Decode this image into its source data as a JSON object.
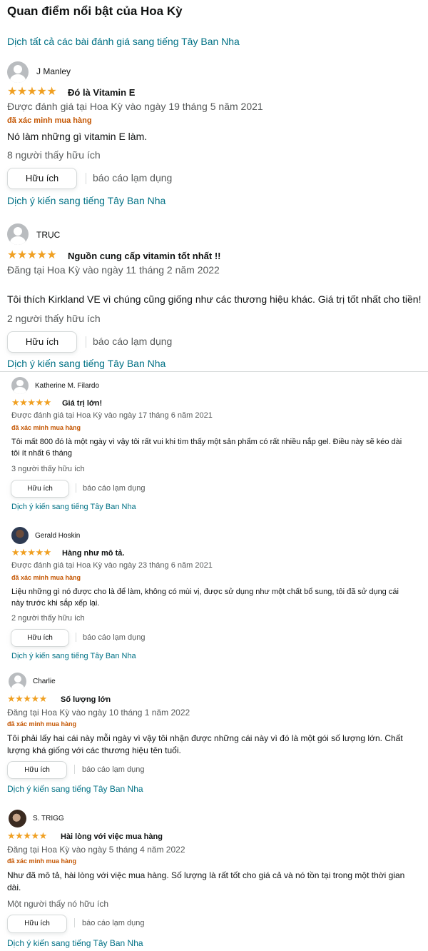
{
  "heading": "Quan điểm nổi bật của Hoa Kỳ",
  "translate_all": "Dịch tất cả các bài đánh giá sang tiếng Tây Ban Nha",
  "helpful_label": "Hữu ích",
  "report_label": "báo cáo lạm dụng",
  "translate_label": "Dịch ý kiến sang tiếng Tây Ban Nha",
  "stars_text": "★★★★★",
  "colors": {
    "link": "#007185",
    "star": "#f0a022",
    "verified": "#c45500"
  },
  "reviews": [
    {
      "name": "J Manley",
      "rating": 5,
      "title": "Đó là Vitamin E",
      "date": "Được đánh giá tại Hoa Kỳ vào ngày 19 tháng 5 năm 2021",
      "verified": "đã xác minh mua hàng",
      "body": "Nó làm những gì vitamin E làm.",
      "helpful": "8 người thấy hữu ích",
      "avatar": "avatar-generic-icon"
    },
    {
      "name": "TRỤC",
      "rating": 5,
      "title": "Nguồn cung cấp vitamin tốt nhất !!",
      "date": "Đăng tại Hoa Kỳ vào ngày 11 tháng 2 năm 2022",
      "body": "Tôi thích Kirkland VE vì chúng cũng giống như các thương hiệu khác. Giá trị tốt nhất cho tiền!",
      "helpful": "2 người thấy hữu ích",
      "avatar": "avatar-generic-icon"
    },
    {
      "name": "Katherine M. Filardo",
      "rating": 5,
      "title": "Giá trị lớn!",
      "date": "Được đánh giá tại Hoa Kỳ vào ngày 17 tháng 6 năm 2021",
      "verified": "đã xác minh mua hàng",
      "body": "Tôi mất 800 đó là một ngày vì vậy tôi rất vui khi tìm thấy một sản phẩm có rất nhiều nắp gel. Điều này sẽ kéo dài tôi ít nhất 6 tháng",
      "helpful": "3 người thấy hữu ích",
      "avatar": "avatar-generic-icon"
    },
    {
      "name": "Gerald Hoskin",
      "rating": 5,
      "title": "Hàng như mô tả.",
      "date": "Được đánh giá tại Hoa Kỳ vào ngày 23 tháng 6 năm 2021",
      "verified": "đã xác minh mua hàng",
      "body": "Liệu những gì nó được cho là để làm, không có mùi vị, được sử dụng như một chất bổ sung, tôi đã sử dụng cái này trước khi sắp xếp lại.",
      "helpful": "2 người thấy hữu ích",
      "avatar": "avatar-photo"
    },
    {
      "name": "Charlie",
      "rating": 5,
      "title": "Số lượng lớn",
      "date": "Đăng tại Hoa Kỳ vào ngày 10 tháng 1 năm 2022",
      "verified": "đã xác minh mua hàng",
      "body": "Tôi phải lấy hai cái này mỗi ngày vì vậy tôi nhận được những cái này vì đó là một gói số lượng lớn. Chất lượng khá giống với các thương hiệu tên tuổi.",
      "avatar": "avatar-generic-icon"
    },
    {
      "name": "S. TRIGG",
      "rating": 5,
      "title": "Hài lòng với việc mua hàng",
      "date": "Đăng tại Hoa Kỳ vào ngày 5 tháng 4 năm 2022",
      "verified": "đã xác minh mua hàng",
      "body": "Như đã mô tả, hài lòng với việc mua hàng. Số lượng là rất tốt cho giá cả và nó tồn tại trong một thời gian dài.",
      "helpful": "Một người thấy nó hữu ích",
      "avatar": "avatar-photo"
    }
  ]
}
